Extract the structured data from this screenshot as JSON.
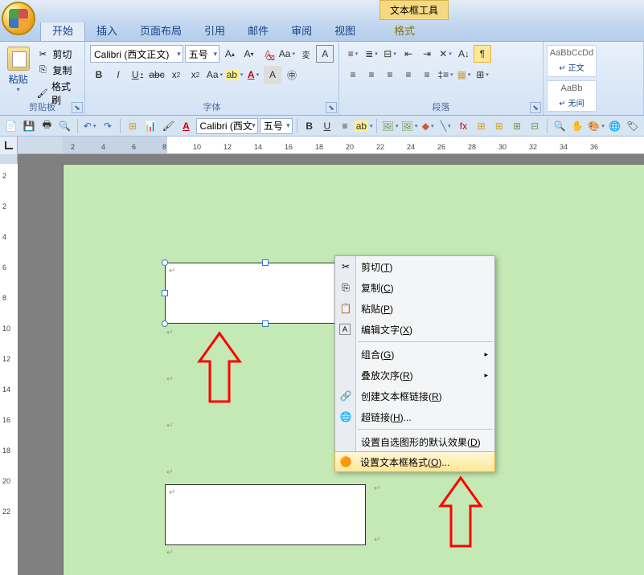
{
  "title_contextual": "文本框工具",
  "tabs": {
    "home": "开始",
    "insert": "插入",
    "layout": "页面布局",
    "ref": "引用",
    "mail": "邮件",
    "review": "审阅",
    "view": "视图",
    "format": "格式"
  },
  "clipboard": {
    "paste": "粘贴",
    "cut": "剪切",
    "copy": "复制",
    "painter": "格式刷",
    "group_label": "剪贴板"
  },
  "font": {
    "name": "Calibri (西文正文)",
    "size": "五号",
    "group_label": "字体"
  },
  "paragraph": {
    "group_label": "段落"
  },
  "styles": {
    "normal_preview": "AaBbCcDd",
    "normal_label": "↵ 正文",
    "nosp_preview": "AaBb",
    "nosp_label": "↵ 无间"
  },
  "qat": {
    "font_name": "Calibri (西文",
    "font_size": "五号"
  },
  "ruler_h": [
    "2",
    "4",
    "6",
    "8",
    "10",
    "12",
    "14",
    "16",
    "18",
    "20",
    "22",
    "24",
    "26",
    "28",
    "30",
    "32",
    "34",
    "36"
  ],
  "ruler_v": [
    "2",
    "2",
    "4",
    "6",
    "8",
    "10",
    "12",
    "14",
    "16",
    "18",
    "20",
    "22"
  ],
  "context_menu": {
    "cut": "剪切(T)",
    "copy": "复制(C)",
    "paste": "粘贴(P)",
    "edit_text": "编辑文字(X)",
    "group": "组合(G)",
    "order": "叠放次序(R)",
    "create_link": "创建文本框链接(R)",
    "hyperlink": "超链接(H)...",
    "set_default": "设置自选图形的默认效果(D)",
    "format_textbox": "设置文本框格式(O)..."
  }
}
